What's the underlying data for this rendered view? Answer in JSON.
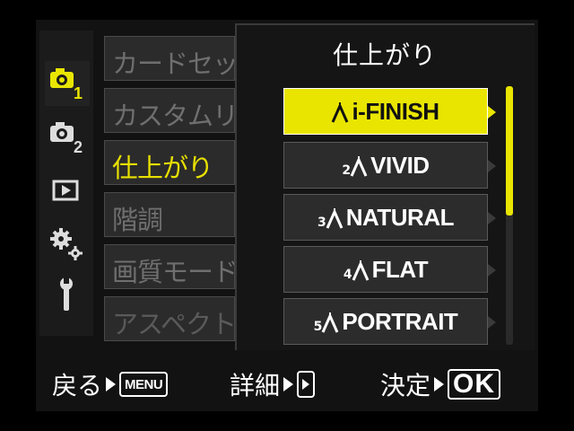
{
  "tabs": [
    {
      "name": "shooting-menu-1",
      "icon": "camera-1-icon",
      "active": true
    },
    {
      "name": "shooting-menu-2",
      "icon": "camera-2-icon",
      "active": false
    },
    {
      "name": "playback-menu",
      "icon": "playback-icon",
      "active": false
    },
    {
      "name": "custom-menu",
      "icon": "gears-icon",
      "active": false
    },
    {
      "name": "setup-menu",
      "icon": "wrench-icon",
      "active": false
    }
  ],
  "tab_numbers": {
    "camera1": "1",
    "camera2": "2"
  },
  "menu": {
    "items": [
      {
        "label": "カードセット"
      },
      {
        "label": "カスタムリセット"
      },
      {
        "label": "仕上がり"
      },
      {
        "label": "階調"
      },
      {
        "label": "画質モード"
      },
      {
        "label": "アスペクト"
      }
    ],
    "selected_index": 2
  },
  "panel": {
    "title": "仕上がり",
    "options": [
      {
        "num": "",
        "label": "i-FINISH",
        "selected": true
      },
      {
        "num": "2",
        "label": "VIVID",
        "selected": false
      },
      {
        "num": "3",
        "label": "NATURAL",
        "selected": false
      },
      {
        "num": "4",
        "label": "FLAT",
        "selected": false
      },
      {
        "num": "5",
        "label": "PORTRAIT",
        "selected": false
      }
    ],
    "scroll_fraction": 0.5
  },
  "help": {
    "back_label": "戻る",
    "back_key": "MENU",
    "detail_label": "詳細",
    "confirm_label": "決定",
    "confirm_key": "OK"
  },
  "colors": {
    "accent": "#e9e500",
    "background": "#121212"
  }
}
